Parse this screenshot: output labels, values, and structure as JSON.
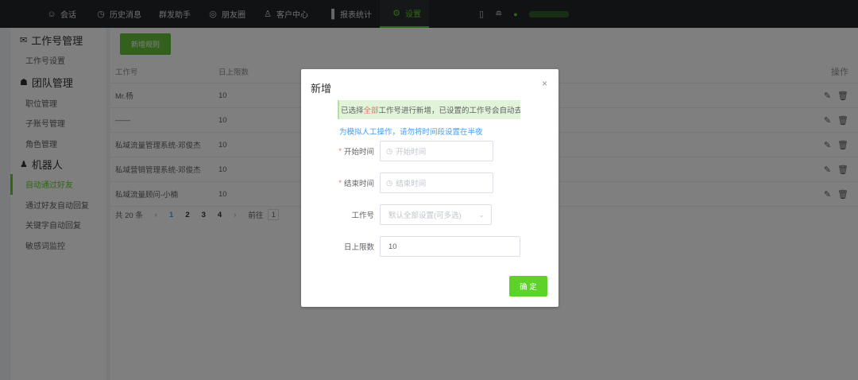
{
  "topnav": {
    "items": [
      {
        "icon": "chat-bubble-icon",
        "glyph": "☺",
        "label": "会话"
      },
      {
        "icon": "clock-icon",
        "glyph": "◷",
        "label": "历史消息"
      },
      {
        "icon": "",
        "glyph": "",
        "label": "群发助手"
      },
      {
        "icon": "aperture-icon",
        "glyph": "◎",
        "label": "朋友圈"
      },
      {
        "icon": "person-icon",
        "glyph": "♙",
        "label": "客户中心"
      },
      {
        "icon": "bar-chart-icon",
        "glyph": "▐",
        "label": "报表统计"
      },
      {
        "icon": "gear-icon",
        "glyph": "⚙",
        "label": "设置"
      }
    ],
    "active_index": 6,
    "right_icons": [
      "book-icon",
      "database-icon",
      "user-icon"
    ],
    "accent_color": "#5fcf2b"
  },
  "sidebar": {
    "groups": [
      {
        "icon": "wechat-icon",
        "glyph": "✉",
        "title": "工作号管理",
        "items": [
          "工作号设置"
        ]
      },
      {
        "icon": "team-icon",
        "glyph": "☗",
        "title": "团队管理",
        "items": [
          "职位管理",
          "子账号管理",
          "角色管理"
        ]
      },
      {
        "icon": "robot-icon",
        "glyph": "♟",
        "title": "机器人",
        "items": [
          "自动通过好友",
          "通过好友自动回复",
          "关键字自动回复",
          "敏感词监控"
        ]
      }
    ],
    "active_item": "自动通过好友"
  },
  "main": {
    "add_rule_label": "新增规则",
    "columns": [
      "工作号",
      "日上限数",
      "",
      "",
      "操作"
    ],
    "rows": [
      {
        "account": "Mr.杨",
        "limit": "10"
      },
      {
        "account": "——",
        "limit": "10"
      },
      {
        "account": "私域流量管理系统-邓俊杰",
        "limit": "10"
      },
      {
        "account": "私域营销管理系统-邓俊杰",
        "limit": "10"
      },
      {
        "account": "私域流量顾问-小楠",
        "limit": "10"
      }
    ],
    "row_action_icons": [
      "edit-icon",
      "trash-icon"
    ],
    "pagination": {
      "total": "共 20 条",
      "pages": [
        "1",
        "2",
        "3",
        "4"
      ],
      "current": "1",
      "goto_label": "前往",
      "goto_value": "1"
    }
  },
  "dialog": {
    "title": "新增",
    "close_glyph": "×",
    "notice_prefix": "已选择",
    "notice_highlight": "全部",
    "notice_suffix": "工作号进行新增，已设置的工作号会自动去重",
    "hint": "为模拟人工操作，请勿将时间段设置在半夜",
    "fields": {
      "start_time": {
        "label": "开始时间",
        "placeholder": "开始时间",
        "required": true
      },
      "end_time": {
        "label": "结束时间",
        "placeholder": "结束时间",
        "required": true
      },
      "account": {
        "label": "工作号",
        "placeholder": "默认全部设置(可多选)"
      },
      "daily_limit": {
        "label": "日上限数",
        "value": "10"
      }
    },
    "confirm_label": "确 定",
    "confirm_color": "#5dd32a"
  }
}
